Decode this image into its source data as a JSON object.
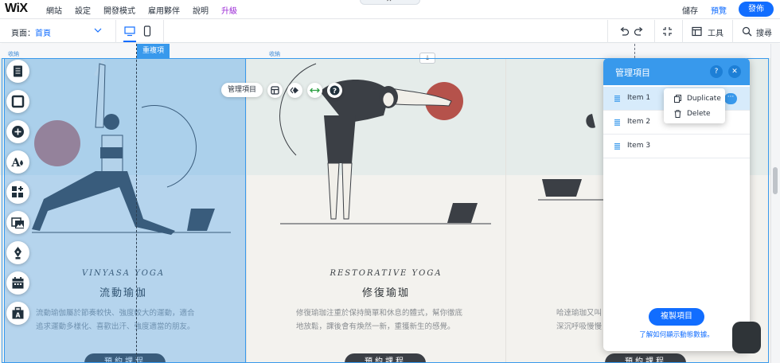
{
  "topbar": {
    "logo": "WiX",
    "menu": [
      "網站",
      "設定",
      "開發模式",
      "雇用夥伴",
      "說明",
      "升級"
    ],
    "save": "儲存",
    "preview": "預覽",
    "publish": "發佈"
  },
  "toolbar": {
    "page_label": "頁面：",
    "page_value": "首頁",
    "tools": "工具",
    "search": "搜尋"
  },
  "canvas": {
    "collapse_label": "收納",
    "duplicate_tab": "重複項",
    "manage_items_pill": "管理項目",
    "cards": [
      {
        "title_en": "VINYASA YOGA",
        "title_zh": "流動瑜伽",
        "desc_lines": [
          "流動瑜伽屬於節奏較快、強度較大的運動，適合",
          "追求運動多樣化、喜歡出汗、強度適當的朋友。"
        ],
        "button": "預約課程"
      },
      {
        "title_en": "RESTORATIVE YOGA",
        "title_zh": "修復瑜珈",
        "desc_lines": [
          "修復瑜珈注重於保持簡單和休息的體式，幫你徹底",
          "地放鬆，課後會有煥然一新，重獲新生的感覺。"
        ],
        "button": "預約課程"
      },
      {
        "desc_lines": [
          "哈達瑜珈又叫",
          "深沉呼吸慢慢"
        ],
        "button": "預約課程"
      }
    ]
  },
  "panel": {
    "title": "管理項目",
    "help": "?",
    "items": [
      "Item 1",
      "Item 2",
      "Item 3"
    ],
    "more": "···",
    "context_menu": [
      "Duplicate",
      "Delete"
    ],
    "duplicate_button": "複製項目",
    "learn_link": "了解如何顯示動態數據。"
  },
  "colors": {
    "accent": "#116dff",
    "panel_header": "#3899ec",
    "selection": "#3899ec",
    "button_dark": "#3b3f45",
    "ball": "#b5524b"
  }
}
